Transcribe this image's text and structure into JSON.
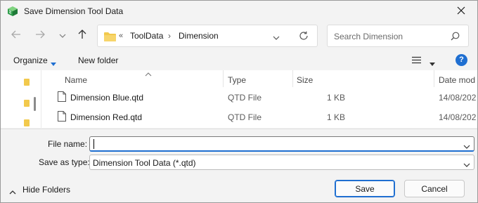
{
  "window": {
    "title": "Save Dimension Tool Data",
    "icon": "app-cube-icon",
    "close_icon": "close-icon"
  },
  "navigation": {
    "back_icon": "arrow-left-icon",
    "forward_icon": "arrow-right-icon",
    "recent_icon": "chevron-down-icon",
    "up_icon": "arrow-up-icon",
    "address": {
      "overflow": "«",
      "crumbs": [
        "ToolData",
        "Dimension"
      ],
      "separator": "›"
    },
    "search": {
      "placeholder": "Search Dimension"
    }
  },
  "toolbar": {
    "organize_label": "Organize",
    "new_folder_label": "New folder",
    "help_label": "?"
  },
  "file_list": {
    "columns": [
      "Name",
      "Type",
      "Size",
      "Date mod"
    ],
    "rows": [
      {
        "name": "Dimension Blue.qtd",
        "type": "QTD File",
        "size": "1 KB",
        "date": "14/08/202"
      },
      {
        "name": "Dimension Red.qtd",
        "type": "QTD File",
        "size": "1 KB",
        "date": "14/08/202"
      }
    ]
  },
  "form": {
    "file_name_label": "File name:",
    "file_name_value": "",
    "save_as_type_label": "Save as type:",
    "save_as_type_value": "Dimension Tool Data (*.qtd)"
  },
  "footer": {
    "hide_folders_label": "Hide Folders",
    "save_label": "Save",
    "cancel_label": "Cancel"
  },
  "colors": {
    "accent": "#1f6fd1",
    "folder": "#f2c94c"
  }
}
